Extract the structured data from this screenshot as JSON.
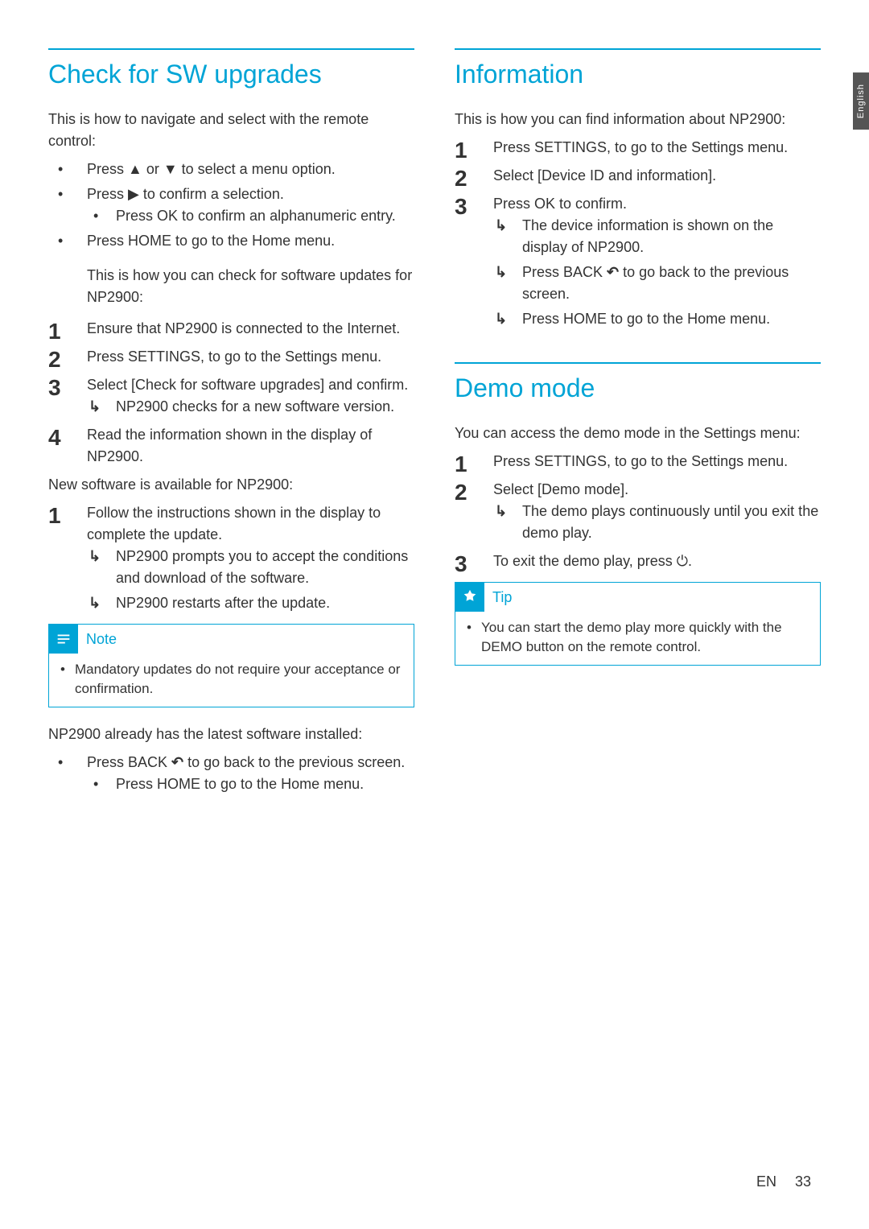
{
  "lang_tab": "English",
  "left": {
    "title": "Check for SW upgrades",
    "intro": "This is how to navigate and select with the remote control:",
    "nav_bullets": [
      "Press ▲ or ▼ to select a menu option.",
      "Press ▶ to confirm a selection.",
      "Press OK to confirm an alphanumeric entry.",
      "Press HOME to go to the Home menu."
    ],
    "check_intro": "This is how you can check for software updates for NP2900:",
    "steps_a": [
      "Ensure that NP2900 is connected to the Internet.",
      "Press SETTINGS, to go to the Settings menu.",
      "Select [Check for software upgrades] and confirm.",
      "Read the information shown in the display of NP2900."
    ],
    "step3_result": "NP2900 checks for a new software version.",
    "new_sw": "New software is available for NP2900:",
    "steps_b": [
      "Follow the instructions shown in the display to complete the update."
    ],
    "step1b_result1": "NP2900 prompts you to accept the conditions and download of the software.",
    "step1b_result2": "NP2900 restarts after the update.",
    "note_title": "Note",
    "note_body": "Mandatory updates do not require your acceptance or confirmation.",
    "already_latest": "NP2900 already has the latest software installed:",
    "latest_bullet": "Press BACK ",
    "latest_bullet_after": " to go back to the previous screen.",
    "latest_sub": "Press HOME to go to the Home menu."
  },
  "right": {
    "info_title": "Information",
    "info_intro": "This is how you can find information about NP2900:",
    "info_steps": [
      "Press SETTINGS, to go to the Settings menu.",
      "Select [Device ID and information].",
      "Press OK to confirm."
    ],
    "info_result1": "The device information is shown on the display of NP2900.",
    "info_result2_pre": "Press BACK ",
    "info_result2_post": " to go back to the previous screen.",
    "info_result3": "Press HOME to go to the Home menu.",
    "demo_title": "Demo mode",
    "demo_intro": "You can access the demo mode in the Settings menu:",
    "demo_steps": [
      "Press SETTINGS, to go to the Settings menu.",
      "Select [Demo mode].",
      "To exit the demo play, press ⏻."
    ],
    "demo_result": "The demo plays continuously until you exit the demo play.",
    "tip_title": "Tip",
    "tip_body": "You can start the demo play more quickly with the DEMO button on the remote control."
  },
  "footer": {
    "lang": "EN",
    "page": "33"
  }
}
